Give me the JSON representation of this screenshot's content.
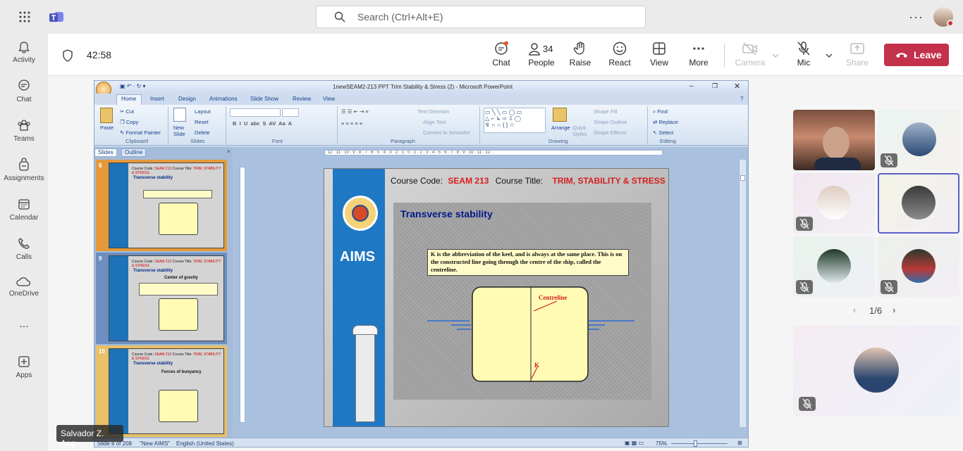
{
  "search": {
    "placeholder": "Search (Ctrl+Alt+E)"
  },
  "rail": [
    {
      "label": "Activity",
      "icon": "bell-icon"
    },
    {
      "label": "Chat",
      "icon": "chat-icon"
    },
    {
      "label": "Teams",
      "icon": "teams-icon"
    },
    {
      "label": "Assignments",
      "icon": "backpack-icon"
    },
    {
      "label": "Calendar",
      "icon": "calendar-icon"
    },
    {
      "label": "Calls",
      "icon": "phone-icon"
    },
    {
      "label": "OneDrive",
      "icon": "cloud-icon"
    },
    {
      "label": "...",
      "icon": "more-icon"
    },
    {
      "label": "Apps",
      "icon": "apps-icon"
    }
  ],
  "meeting": {
    "timer": "42:58",
    "buttons": {
      "chat": "Chat",
      "people": "People",
      "people_count": "34",
      "raise": "Raise",
      "react": "React",
      "view": "View",
      "more": "More",
      "camera": "Camera",
      "mic": "Mic",
      "share": "Share",
      "leave": "Leave"
    }
  },
  "ppt": {
    "title": "1newSEAM2-213 PPT Trim Stability & Stress (2) - Microsoft PowerPoint",
    "tabs": [
      "Home",
      "Insert",
      "Design",
      "Animations",
      "Slide Show",
      "Review",
      "View"
    ],
    "clipboard": {
      "paste": "Paste",
      "cut": "Cut",
      "copy": "Copy",
      "format_painter": "Format Painter",
      "label": "Clipboard"
    },
    "slides_group": {
      "new_slide": "New Slide",
      "layout": "Layout",
      "reset": "Reset",
      "delete": "Delete",
      "label": "Slides"
    },
    "font_label": "Font",
    "paragraph": {
      "text_direction": "Text Direction",
      "align_text": "Align Text",
      "convert": "Convert to SmartArt",
      "label": "Paragraph"
    },
    "drawing": {
      "arrange": "Arrange",
      "quick_styles": "Quick Styles",
      "shape_fill": "Shape Fill",
      "shape_outline": "Shape Outline",
      "shape_effects": "Shape Effects",
      "label": "Drawing"
    },
    "editing": {
      "find": "Find",
      "replace": "Replace",
      "select": "Select",
      "label": "Editing"
    },
    "pane_tabs": [
      "Slides",
      "Outline"
    ],
    "thumbs": [
      {
        "num": "8",
        "title": "Transverse stability",
        "sub": ""
      },
      {
        "num": "9",
        "title": "Transverse stability",
        "sub": "Center of gravity"
      },
      {
        "num": "10",
        "title": "Transverse stability",
        "sub": "Forces of buoyancy"
      }
    ],
    "slide": {
      "course_code_label": "Course Code:",
      "course_code": "SEAM 213",
      "course_title_label": "Course Title:",
      "course_title": "TRIM, STABILITY & STRESS",
      "heading": "Transverse stability",
      "body": "K is the abbreviation of the keel, and is always at the same place. This is on the constructed line going through the centre of the ship, called the centreline.",
      "centreline": "Centreline",
      "k_label": "K",
      "logo_text": "AIMS"
    },
    "status": {
      "slide": "Slide 8 of 208",
      "theme": "\"New AIMS\"",
      "language": "English (United States)",
      "zoom": "75%"
    }
  },
  "presenter_name": "Salvador Z. Ang",
  "pagination": "1/6"
}
